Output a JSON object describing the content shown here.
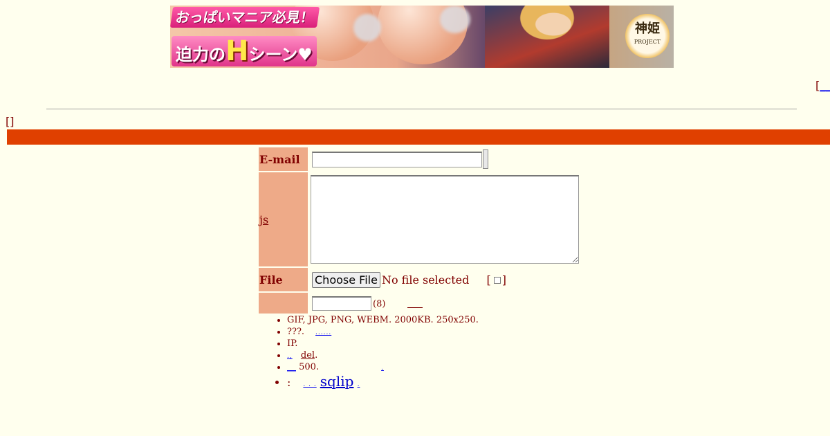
{
  "banner": {
    "top_text": "おっぱいマニア必見！",
    "bottom_text_before": "迫力の",
    "bottom_text_big": "H",
    "bottom_text_after": "シーン♥",
    "logo_kanji": "神姫",
    "logo_sub": "PROJECT"
  },
  "top_right": {
    "bracket_open": "[",
    "link_text": "__"
  },
  "bracket_text": "[]",
  "form": {
    "email_label": "E-mail",
    "email_value": "",
    "comment_label": "js",
    "comment_value": "",
    "file_label": "File",
    "file_button": "Choose File",
    "file_status": "No file selected",
    "spoiler_open": "[",
    "spoiler_close": "]",
    "password_value": "",
    "password_hint": "(8)"
  },
  "rules": {
    "items": [
      "GIF, JPG, PNG, WEBM. 2000KB. 250x250.",
      "???.",
      "IP.",
      "del.",
      "500."
    ],
    "rule2_link": "......",
    "rule4_prefix": ".,",
    "rule4_link": "del",
    "rule4_suffix": ".",
    "rule5_link": "__",
    "rule5_trail": ".",
    "rule6_colon": ":",
    "rule6_dots": ". . .",
    "rule6_link": "sqlip",
    "rule6_trail": "."
  },
  "colors": {
    "background": "#ffffee",
    "text": "#800000",
    "accent_bar": "#e04000",
    "label_bg": "#eeaa88"
  }
}
